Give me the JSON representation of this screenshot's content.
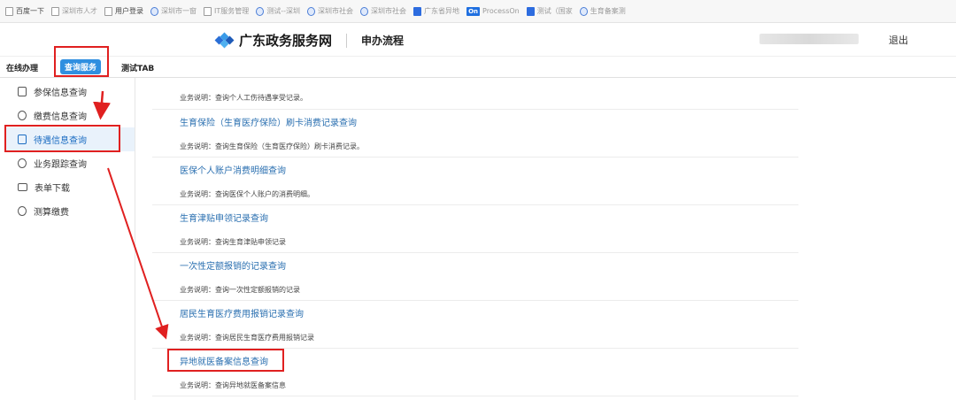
{
  "bookmarks": [
    {
      "label": "百度一下",
      "icon": "page-icon"
    },
    {
      "label": "深圳市人才",
      "icon": "page-icon"
    },
    {
      "label": "用户登录",
      "icon": "page-icon"
    },
    {
      "label": "深圳市一窗",
      "icon": "globe-icon"
    },
    {
      "label": "IT服务管理",
      "icon": "page-icon"
    },
    {
      "label": "测试--深圳",
      "icon": "globe-icon"
    },
    {
      "label": "深圳市社会",
      "icon": "globe-icon"
    },
    {
      "label": "深圳市社会",
      "icon": "globe-icon"
    },
    {
      "label": "广东省异地",
      "icon": "blue-square-icon"
    },
    {
      "label": "ProcessOn",
      "icon": "processon-icon",
      "badge": "On"
    },
    {
      "label": "测试（国家",
      "icon": "blue-square-icon"
    },
    {
      "label": "生育备案测",
      "icon": "globe-icon"
    }
  ],
  "header": {
    "site_name": "广东政务服务网",
    "page_sub": "申办流程",
    "logout": "退出"
  },
  "tabs": [
    {
      "label": "在线办理",
      "active": false
    },
    {
      "label": "查询服务",
      "active": true
    },
    {
      "label": "测试TAB",
      "active": false
    }
  ],
  "sidebar": [
    {
      "label": "参保信息查询",
      "icon": "edit-doc-icon",
      "active": false
    },
    {
      "label": "缴费信息查询",
      "icon": "user-money-icon",
      "active": false
    },
    {
      "label": "待遇信息查询",
      "icon": "doc-search-icon",
      "active": true
    },
    {
      "label": "业务跟踪查询",
      "icon": "refresh-icon",
      "active": false
    },
    {
      "label": "表单下载",
      "icon": "form-icon",
      "active": false
    },
    {
      "label": "测算缴费",
      "icon": "calc-money-icon",
      "active": false
    }
  ],
  "content": {
    "first_desc": "业务说明：查询个人工伤待遇享受记录。",
    "rows": [
      {
        "link": "生育保险（生育医疗保险）刷卡消费记录查询",
        "desc": "业务说明：查询生育保险（生育医疗保险）刷卡消费记录。"
      },
      {
        "link": "医保个人账户消费明细查询",
        "desc": "业务说明：查询医保个人账户的消费明细。"
      },
      {
        "link": "生育津贴申领记录查询",
        "desc": "业务说明：查询生育津贴申领记录"
      },
      {
        "link": "一次性定额报销的记录查询",
        "desc": "业务说明：查询一次性定额报销的记录"
      },
      {
        "link": "居民生育医疗费用报销记录查询",
        "desc": "业务说明：查询居民生育医疗费用报销记录"
      },
      {
        "link": "异地就医备案信息查询",
        "desc": "业务说明：查询异地就医备案信息"
      }
    ]
  },
  "colors": {
    "accent": "#2f8fe0",
    "link": "#2a6fb0",
    "annotation_red": "#e02020"
  }
}
